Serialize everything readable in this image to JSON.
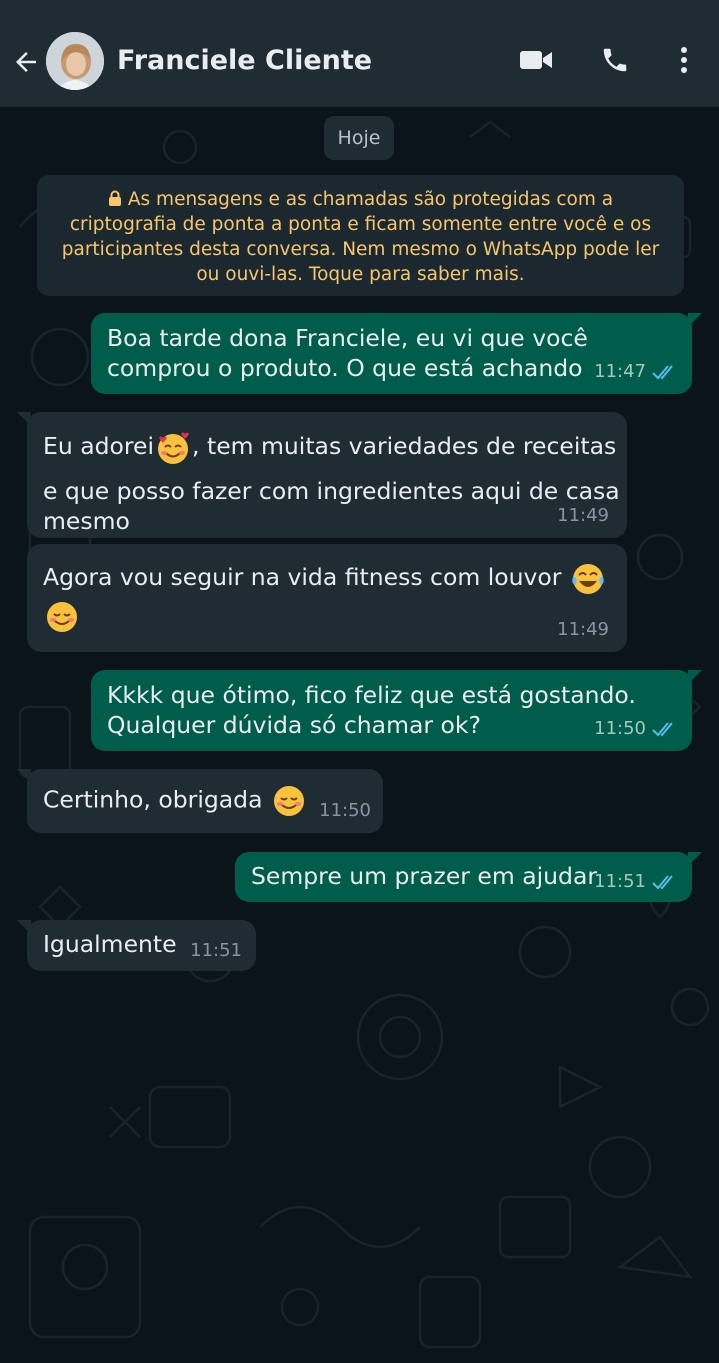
{
  "header": {
    "title": "Franciele Cliente"
  },
  "date_chip": "Hoje",
  "encryption_notice": {
    "line1": "As mensagens e as chamadas são protegidas com a",
    "line2": "criptografia de ponta a ponta e ficam somente entre você e os",
    "line3": "participantes desta conversa. Nem mesmo o WhatsApp pode ler",
    "line4": "ou ouvi-las. Toque para saber mais."
  },
  "messages": [
    {
      "from": "me",
      "line1": "Boa tarde dona Franciele, eu vi que você",
      "line2": "comprou o produto. O que está achando",
      "time": "11:47"
    },
    {
      "from": "contact",
      "line1_a": "Eu adorei",
      "line1_b": ", tem muitas variedades de receitas",
      "line2": "e que posso fazer com ingredientes aqui de casa",
      "line3": "mesmo",
      "time": "11:49",
      "emoji": "smiling-face-with-hearts"
    },
    {
      "from": "contact",
      "line1": "Agora vou seguir na vida fitness com louvor",
      "time": "11:49",
      "emojis": [
        "face-with-tears-of-joy",
        "smiling-face"
      ]
    },
    {
      "from": "me",
      "line1": "Kkkk que ótimo, fico feliz que está gostando.",
      "line2": "Qualquer dúvida só chamar ok?",
      "time": "11:50"
    },
    {
      "from": "contact",
      "line1": "Certinho, obrigada",
      "time": "11:50",
      "emoji": "smiling-face"
    },
    {
      "from": "me",
      "line1": "Sempre um prazer em ajudar",
      "time": "11:51"
    },
    {
      "from": "contact",
      "line1": "Igualmente",
      "time": "11:51"
    }
  ],
  "icons": {
    "back": "arrow-left-icon",
    "video": "video-call-icon",
    "call": "phone-icon",
    "menu": "more-vertical-icon",
    "lock": "lock-icon",
    "read": "double-check-icon"
  },
  "colors": {
    "header_bg": "#1f2c34",
    "chat_bg": "#0b141a",
    "outgoing_bubble": "#005c4b",
    "incoming_bubble": "#1f2c34",
    "notice_text": "#f7c66a",
    "read_tick": "#53bdeb"
  }
}
